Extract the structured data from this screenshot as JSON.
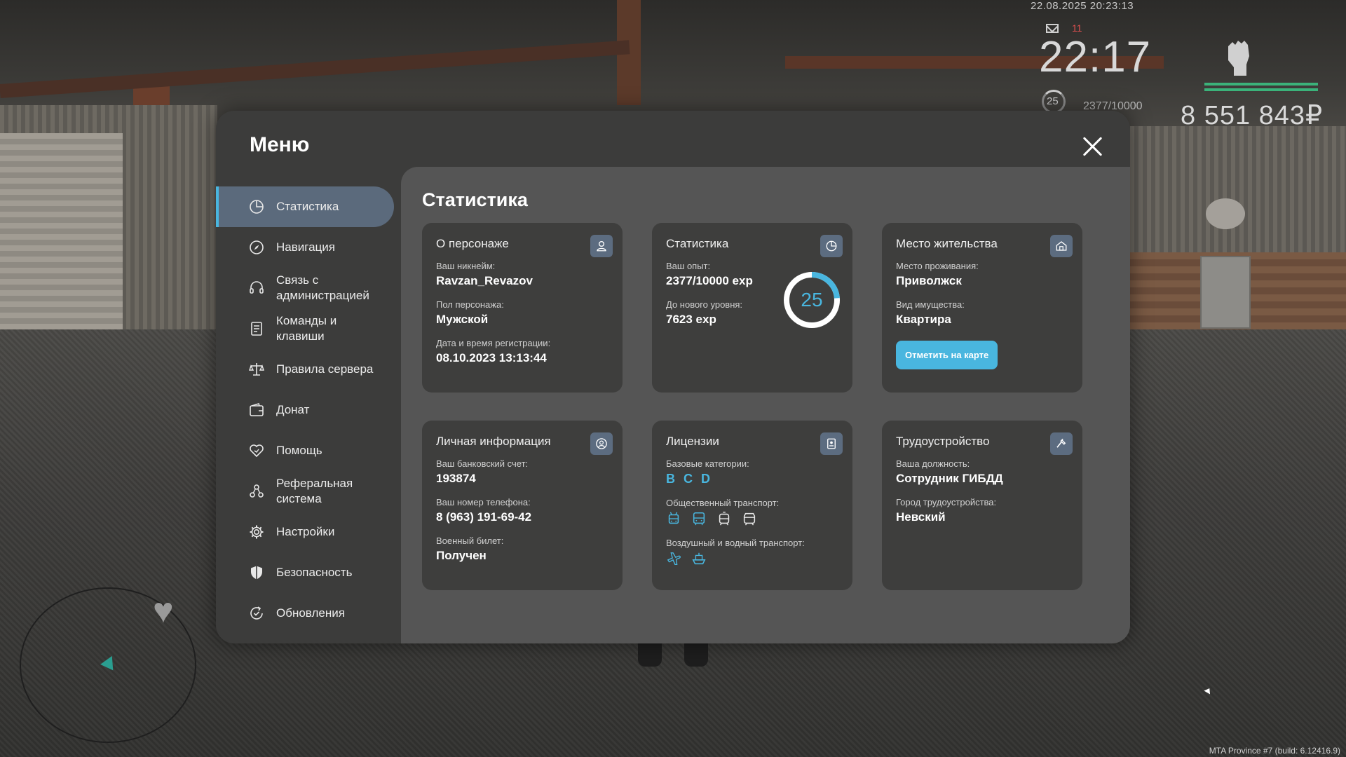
{
  "hud": {
    "datetime": "22.08.2025 20:23:13",
    "mail_count": "11",
    "time": "22:17",
    "level": "25",
    "exp": "2377/10000",
    "money": "8 551 843₽"
  },
  "build": "MTA Province #7 (build: 6.12416.9)",
  "menu": {
    "title": "Меню",
    "items": [
      {
        "label": "Статистика",
        "icon": "pie-chart-icon",
        "active": true
      },
      {
        "label": "Навигация",
        "icon": "compass-icon"
      },
      {
        "label": "Связь с администрацией",
        "icon": "headset-icon"
      },
      {
        "label": "Команды и клавиши",
        "icon": "document-list-icon"
      },
      {
        "label": "Правила сервера",
        "icon": "scales-icon"
      },
      {
        "label": "Донат",
        "icon": "wallet-icon"
      },
      {
        "label": "Помощь",
        "icon": "heart-hands-icon"
      },
      {
        "label": "Реферальная система",
        "icon": "people-network-icon"
      },
      {
        "label": "Настройки",
        "icon": "gear-icon"
      },
      {
        "label": "Безопасность",
        "icon": "shield-icon"
      },
      {
        "label": "Обновления",
        "icon": "refresh-check-icon"
      }
    ]
  },
  "content": {
    "title": "Статистика",
    "character": {
      "title": "О персонаже",
      "icon": "user-icon",
      "nickname_label": "Ваш никнейм:",
      "nickname": "Ravzan_Revazov",
      "gender_label": "Пол персонажа:",
      "gender": "Мужской",
      "reg_label": "Дата и время регистрации:",
      "reg": "08.10.2023 13:13:44"
    },
    "stats": {
      "title": "Статистика",
      "icon": "pie-chart-icon",
      "exp_label": "Ваш опыт:",
      "exp": "2377/10000 exp",
      "next_label": "До нового уровня:",
      "next": "7623 exp",
      "level": "25",
      "progress": 0.2377,
      "accent": "#49b6df"
    },
    "residence": {
      "title": "Место жительства",
      "icon": "house-icon",
      "place_label": "Место проживания:",
      "place": "Приволжск",
      "property_label": "Вид имущества:",
      "property": "Квартира",
      "map_button": "Отметить на карте"
    },
    "personal": {
      "title": "Личная информация",
      "icon": "user-circle-icon",
      "bank_label": "Ваш банковский счет:",
      "bank": "193874",
      "phone_label": "Ваш номер телефона:",
      "phone": "8 (963) 191-69-42",
      "military_label": "Военный билет:",
      "military": "Получен"
    },
    "licenses": {
      "title": "Лицензии",
      "icon": "id-card-icon",
      "base_label": "Базовые категории:",
      "base": [
        "B",
        "C",
        "D"
      ],
      "public_label": "Общественный транспорт:",
      "public_icons": [
        "trolleybus-icon",
        "bus-icon",
        "tram-icon",
        "metro-icon"
      ],
      "airwater_label": "Воздушный и водный транспорт:",
      "airwater_icons": [
        "airplane-icon",
        "ship-icon"
      ]
    },
    "employment": {
      "title": "Трудоустройство",
      "icon": "hammer-icon",
      "position_label": "Ваша должность:",
      "position": "Сотрудник ГИБДД",
      "city_label": "Город трудоустройства:",
      "city": "Невский"
    }
  }
}
